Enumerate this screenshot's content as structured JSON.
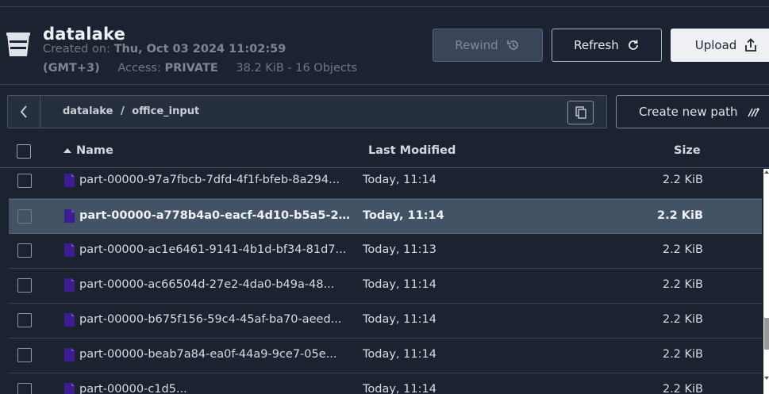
{
  "bucket": {
    "name": "datalake",
    "created_label": "Created on:",
    "created_value": "Thu, Oct 03 2024 11:02:59",
    "timezone": "(GMT+3)",
    "access_label": "Access:",
    "access_value": "PRIVATE",
    "stats": "38.2 KiB - 16 Objects",
    "icon": "bucket-icon"
  },
  "toolbar": {
    "rewind_label": "Rewind",
    "refresh_label": "Refresh",
    "upload_label": "Upload"
  },
  "path": {
    "root": "datalake",
    "separator": "/",
    "current": "office_input",
    "create_new_path_label": "Create new path"
  },
  "table": {
    "columns": {
      "name": "Name",
      "modified": "Last Modified",
      "size": "Size"
    },
    "sort": "name-ascending",
    "rows": [
      {
        "name": "part-00000-97a7fbcb-7dfd-4f1f-bfeb-8a294...",
        "modified": "Today, 11:14",
        "size": "2.2 KiB",
        "selected": false
      },
      {
        "name": "part-00000-a778b4a0-eacf-4d10-b5a5-2a...",
        "modified": "Today, 11:14",
        "size": "2.2 KiB",
        "selected": true
      },
      {
        "name": "part-00000-ac1e6461-9141-4b1d-bf34-81d7...",
        "modified": "Today, 11:13",
        "size": "2.2 KiB",
        "selected": false
      },
      {
        "name": "part-00000-ac66504d-27e2-4da0-b49a-48...",
        "modified": "Today, 11:14",
        "size": "2.2 KiB",
        "selected": false
      },
      {
        "name": "part-00000-b675f156-59c4-45af-ba70-aeed...",
        "modified": "Today, 11:14",
        "size": "2.2 KiB",
        "selected": false
      },
      {
        "name": "part-00000-beab7a84-ea0f-44a9-9ce7-05e...",
        "modified": "Today, 11:14",
        "size": "2.2 KiB",
        "selected": false
      },
      {
        "name": "part-00000-c1d5...",
        "modified": "Today, 11:14",
        "size": "2.2 KiB",
        "selected": false
      }
    ]
  },
  "colors": {
    "background": "#1c2330",
    "file_icon": "#3b1d8f",
    "selected_row": "#445266"
  }
}
